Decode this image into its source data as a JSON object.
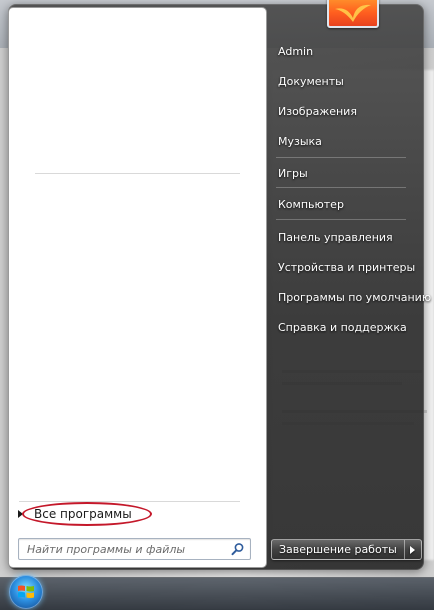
{
  "start_menu": {
    "all_programs_label": "Все программы",
    "search": {
      "placeholder": "Найти программы и файлы",
      "value": ""
    },
    "right_items": [
      "Admin",
      "Документы",
      "Изображения",
      "Музыка",
      "Игры",
      "Компьютер",
      "Панель управления",
      "Устройства и принтеры",
      "Программы по умолчанию",
      "Справка и поддержка"
    ],
    "shutdown_label": "Завершение работы"
  },
  "icons": {
    "search": "search-icon",
    "start": "windows-logo-icon",
    "user_picture": "user-avatar"
  },
  "colors": {
    "highlight_circle": "#c4182a",
    "menu_dark": "#2f2f2f",
    "left_pane": "#ffffff"
  }
}
